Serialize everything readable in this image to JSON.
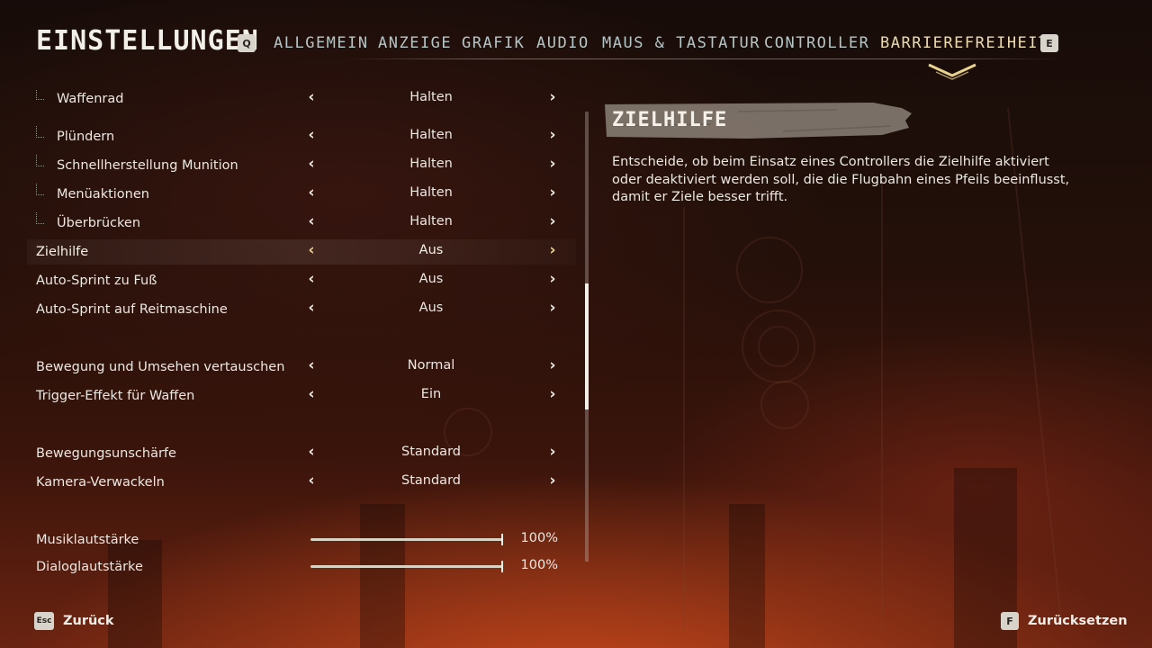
{
  "header": {
    "title": "EINSTELLUNGEN",
    "prev_key": "Q",
    "next_key": "E",
    "tabs": [
      {
        "label": "ALLGEMEIN",
        "active": false
      },
      {
        "label": "ANZEIGE",
        "active": false
      },
      {
        "label": "GRAFIK",
        "active": false
      },
      {
        "label": "AUDIO",
        "active": false
      },
      {
        "label": "MAUS & TASTATUR",
        "active": false
      },
      {
        "label": "CONTROLLER",
        "active": false
      },
      {
        "label": "BARRIEREFREIHEIT",
        "active": true
      }
    ]
  },
  "settings": {
    "rows": [
      {
        "label": "Waffenrad",
        "value": "Halten",
        "sub": true,
        "partial": true
      },
      {
        "label": "Plündern",
        "value": "Halten",
        "sub": true
      },
      {
        "label": "Schnellherstellung Munition",
        "value": "Halten",
        "sub": true
      },
      {
        "label": "Menüaktionen",
        "value": "Halten",
        "sub": true
      },
      {
        "label": "Überbrücken",
        "value": "Halten",
        "sub": true
      },
      {
        "label": "Zielhilfe",
        "value": "Aus",
        "selected": true
      },
      {
        "label": "Auto-Sprint zu Fuß",
        "value": "Aus"
      },
      {
        "label": "Auto-Sprint auf Reitmaschine",
        "value": "Aus"
      },
      {
        "label": "Bewegung und Umsehen vertauschen",
        "value": "Normal"
      },
      {
        "label": "Trigger-Effekt für Waffen",
        "value": "Ein"
      },
      {
        "label": "Bewegungsunschärfe",
        "value": "Standard"
      },
      {
        "label": "Kamera-Verwackeln",
        "value": "Standard"
      }
    ],
    "sliders": [
      {
        "label": "Musiklautstärke",
        "value": "100%",
        "fraction": 1.0
      },
      {
        "label": "Dialoglautstärke",
        "value": "100%",
        "fraction": 1.0
      }
    ]
  },
  "scrollbar": {
    "position_fraction": 0.53,
    "thumb_fraction": 0.28
  },
  "info": {
    "title": "ZIELHILFE",
    "description": "Entscheide, ob beim Einsatz eines Controllers die Zielhilfe aktiviert oder deaktiviert werden soll, die die Flugbahn eines Pfeils beeinflusst, damit er Ziele besser trifft."
  },
  "footer": {
    "back_key": "Esc",
    "back_label": "Zurück",
    "reset_key": "F",
    "reset_label": "Zurücksetzen"
  },
  "colors": {
    "active_tab": "#ecdcae",
    "inactive_tab": "#b5c6c6",
    "selected_arrow": "#e9d28f"
  },
  "icons": {
    "prev_arrow": "chevron-left-icon",
    "next_arrow": "chevron-right-icon",
    "tab_indicator": "chevron-down-icon"
  }
}
